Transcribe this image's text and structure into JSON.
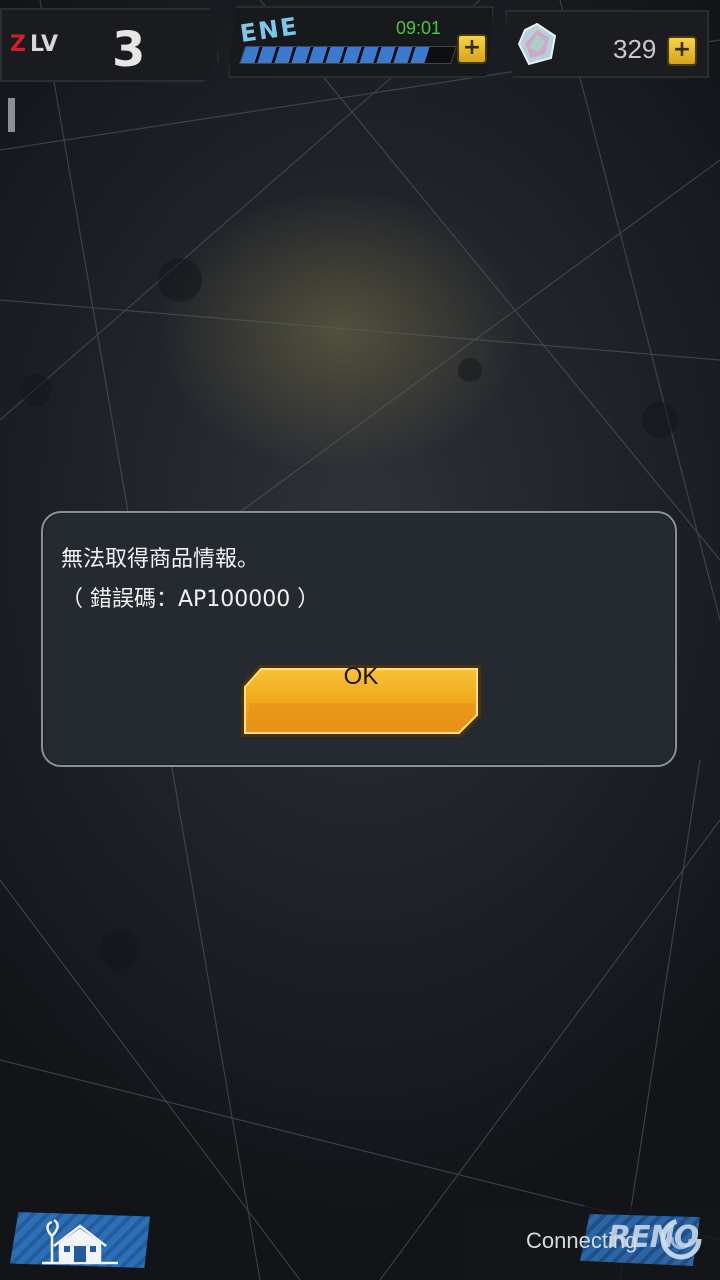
{
  "hud": {
    "level": {
      "prefix_z": "Z",
      "prefix_lv": "LV",
      "value": "3"
    },
    "energy": {
      "label": "ENE",
      "timer": "09:01",
      "fill_fraction": 0.88
    },
    "gems": {
      "value": "329"
    },
    "plus_symbol": "+"
  },
  "dialog": {
    "message_line1": "無法取得商品情報。",
    "message_line2": "（ 錯誤碼：AP100000 ）",
    "ok_label": "OK"
  },
  "footer": {
    "connecting_text": "Connecting",
    "deco_text": "RENO"
  },
  "colors": {
    "accent_ok_button": "#f0a91a",
    "energy_bar": "#3a7bd0",
    "timer_green": "#4fc342",
    "level_red": "#d21e2a"
  }
}
